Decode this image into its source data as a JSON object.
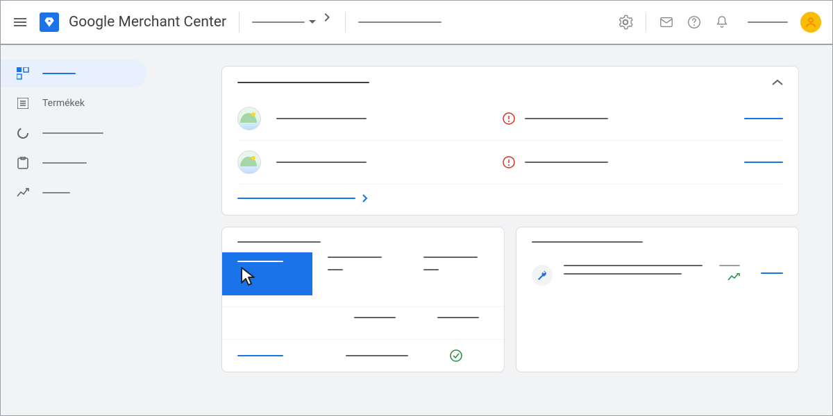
{
  "header": {
    "app_title": "Google Merchant Center",
    "breadcrumb_placeholder": "",
    "search_placeholder": "",
    "account_label": ""
  },
  "sidebar": {
    "items": [
      {
        "label": "",
        "active": true
      },
      {
        "label": "Termékek",
        "active": false
      },
      {
        "label": "",
        "active": false
      },
      {
        "label": "",
        "active": false
      },
      {
        "label": "",
        "active": false
      }
    ]
  },
  "issues_card": {
    "title": "",
    "rows": [
      {
        "name": "",
        "status": "",
        "status_type": "error",
        "action": ""
      },
      {
        "name": "",
        "status": "",
        "status_type": "error",
        "action": ""
      }
    ],
    "footer_link": ""
  },
  "stats_card": {
    "title": "",
    "feature_label": "",
    "columns": [
      {
        "header": "",
        "value": ""
      },
      {
        "header": "",
        "value": ""
      }
    ],
    "row2": [
      {
        "header": "",
        "value": ""
      },
      {
        "header": "",
        "value": ""
      }
    ],
    "footer": {
      "link": "",
      "col2": "",
      "col3_status": "ok"
    }
  },
  "tools_card": {
    "title": "",
    "item": {
      "line1": "",
      "line2": "",
      "trend": "up",
      "stat": "",
      "action": ""
    }
  },
  "colors": {
    "primary": "#1a73e8",
    "accent": "#fbbc04",
    "error": "#d93025",
    "success": "#1e8e3e"
  }
}
